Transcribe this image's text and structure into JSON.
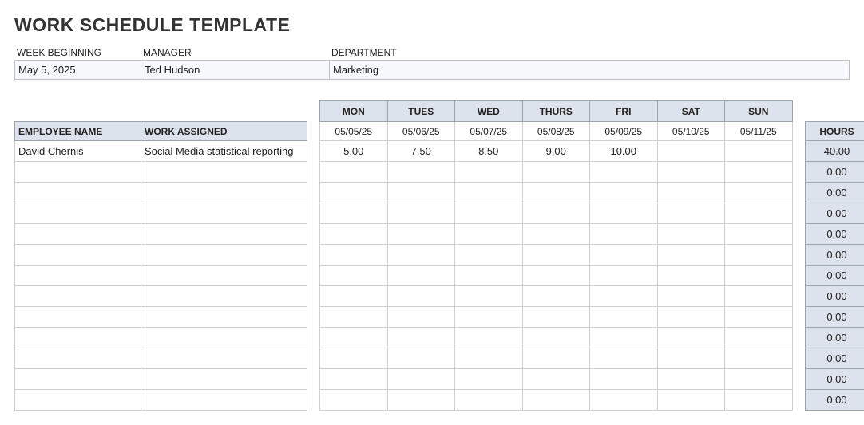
{
  "title": "WORK SCHEDULE TEMPLATE",
  "header": {
    "week_label": "WEEK BEGINNING",
    "manager_label": "MANAGER",
    "dept_label": "DEPARTMENT",
    "week_value": "May 5, 2025",
    "manager_value": "Ted Hudson",
    "dept_value": "Marketing"
  },
  "columns": {
    "employee": "EMPLOYEE NAME",
    "work": "WORK ASSIGNED",
    "hours": "HOURS",
    "days": [
      "MON",
      "TUES",
      "WED",
      "THURS",
      "FRI",
      "SAT",
      "SUN"
    ],
    "dates": [
      "05/05/25",
      "05/06/25",
      "05/07/25",
      "05/08/25",
      "05/09/25",
      "05/10/25",
      "05/11/25"
    ]
  },
  "rows": [
    {
      "employee": "David Chernis",
      "work": "Social Media statistical reporting",
      "d0": "5.00",
      "d1": "7.50",
      "d2": "8.50",
      "d3": "9.00",
      "d4": "10.00",
      "d5": "",
      "d6": "",
      "hours": "40.00"
    },
    {
      "employee": "",
      "work": "",
      "d0": "",
      "d1": "",
      "d2": "",
      "d3": "",
      "d4": "",
      "d5": "",
      "d6": "",
      "hours": "0.00"
    },
    {
      "employee": "",
      "work": "",
      "d0": "",
      "d1": "",
      "d2": "",
      "d3": "",
      "d4": "",
      "d5": "",
      "d6": "",
      "hours": "0.00"
    },
    {
      "employee": "",
      "work": "",
      "d0": "",
      "d1": "",
      "d2": "",
      "d3": "",
      "d4": "",
      "d5": "",
      "d6": "",
      "hours": "0.00"
    },
    {
      "employee": "",
      "work": "",
      "d0": "",
      "d1": "",
      "d2": "",
      "d3": "",
      "d4": "",
      "d5": "",
      "d6": "",
      "hours": "0.00"
    },
    {
      "employee": "",
      "work": "",
      "d0": "",
      "d1": "",
      "d2": "",
      "d3": "",
      "d4": "",
      "d5": "",
      "d6": "",
      "hours": "0.00"
    },
    {
      "employee": "",
      "work": "",
      "d0": "",
      "d1": "",
      "d2": "",
      "d3": "",
      "d4": "",
      "d5": "",
      "d6": "",
      "hours": "0.00"
    },
    {
      "employee": "",
      "work": "",
      "d0": "",
      "d1": "",
      "d2": "",
      "d3": "",
      "d4": "",
      "d5": "",
      "d6": "",
      "hours": "0.00"
    },
    {
      "employee": "",
      "work": "",
      "d0": "",
      "d1": "",
      "d2": "",
      "d3": "",
      "d4": "",
      "d5": "",
      "d6": "",
      "hours": "0.00"
    },
    {
      "employee": "",
      "work": "",
      "d0": "",
      "d1": "",
      "d2": "",
      "d3": "",
      "d4": "",
      "d5": "",
      "d6": "",
      "hours": "0.00"
    },
    {
      "employee": "",
      "work": "",
      "d0": "",
      "d1": "",
      "d2": "",
      "d3": "",
      "d4": "",
      "d5": "",
      "d6": "",
      "hours": "0.00"
    },
    {
      "employee": "",
      "work": "",
      "d0": "",
      "d1": "",
      "d2": "",
      "d3": "",
      "d4": "",
      "d5": "",
      "d6": "",
      "hours": "0.00"
    },
    {
      "employee": "",
      "work": "",
      "d0": "",
      "d1": "",
      "d2": "",
      "d3": "",
      "d4": "",
      "d5": "",
      "d6": "",
      "hours": "0.00"
    }
  ]
}
